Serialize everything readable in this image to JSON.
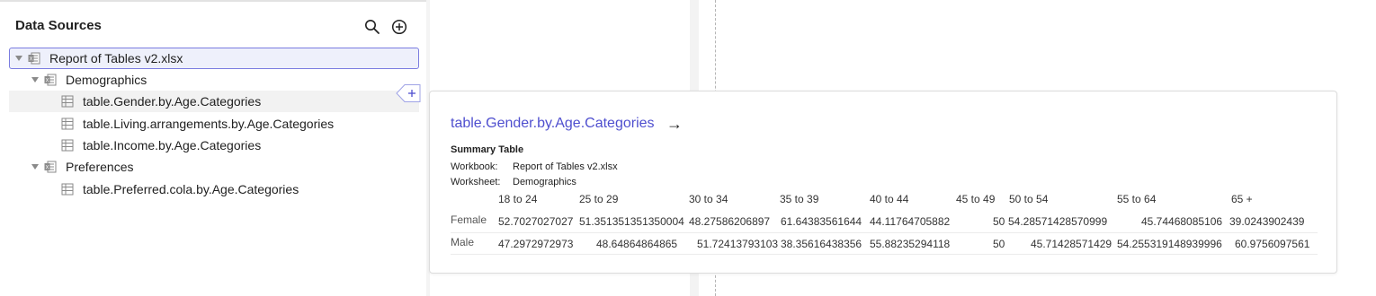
{
  "sidebar": {
    "title": "Data Sources",
    "icons": [
      "search-icon",
      "add-circle-icon"
    ],
    "tree": [
      {
        "label": "Report of Tables v2.xlsx",
        "icon": "excel-file-icon"
      },
      {
        "label": "Demographics",
        "icon": "excel-sheet-icon"
      },
      {
        "label": "table.Gender.by.Age.Categories",
        "icon": "table-icon"
      },
      {
        "label": "table.Living.arrangements.by.Age.Categories",
        "icon": "table-icon"
      },
      {
        "label": "table.Income.by.Age.Categories",
        "icon": "table-icon"
      },
      {
        "label": "Preferences",
        "icon": "excel-sheet-icon"
      },
      {
        "label": "table.Preferred.cola.by.Age.Categories",
        "icon": "table-icon"
      }
    ]
  },
  "preview": {
    "title": "table.Gender.by.Age.Categories",
    "arrow": "→",
    "summary_title": "Summary Table",
    "workbook_label": "Workbook:",
    "workbook": "Report of Tables v2.xlsx",
    "worksheet_label": "Worksheet:",
    "worksheet": "Demographics",
    "columns": [
      "18 to 24",
      "25 to 29",
      "30 to 34",
      "35 to 39",
      "40 to 44",
      "45 to 49",
      "50 to 54",
      "55 to 64",
      "65 +"
    ],
    "rows": [
      {
        "label": "Female",
        "values": [
          "52.7027027027",
          "51.351351351350004",
          "48.27586206897",
          "61.64383561644",
          "44.11764705882",
          "50",
          "54.28571428570999",
          "45.74468085106",
          "39.0243902439"
        ]
      },
      {
        "label": "Male",
        "values": [
          "47.2972972973",
          "48.64864864865",
          "51.72413793103",
          "38.35616438356",
          "55.88235294118",
          "50",
          "45.71428571429",
          "54.255319148939996",
          "60.9756097561"
        ]
      }
    ]
  },
  "colors": {
    "accent": "#4f4fcf",
    "selected_border": "#7a7ce0",
    "selected_bg": "#eef0fb"
  }
}
